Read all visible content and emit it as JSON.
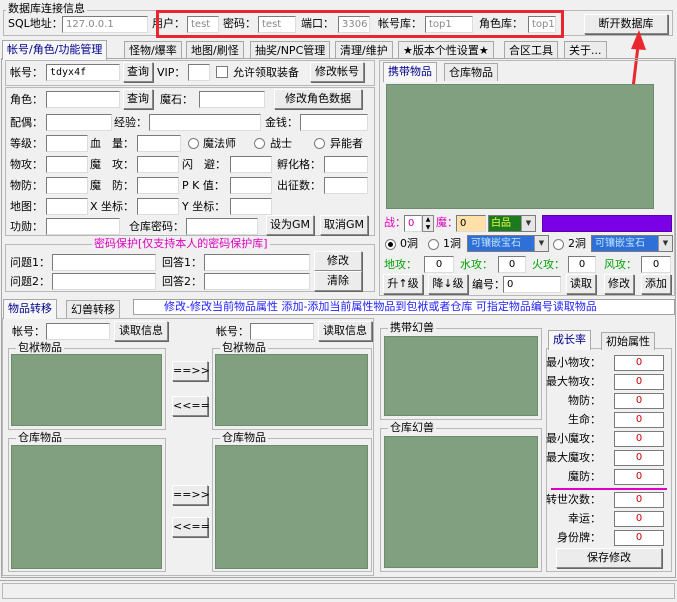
{
  "connection": {
    "group_title": "数据库连接信息",
    "sql_label": "SQL地址：",
    "sql_value": "127.0.0.1",
    "user_label": "用户：",
    "user_value": "test",
    "password_label": "密码：",
    "password_value": "test",
    "port_label": "端口：",
    "port_value": "3306",
    "account_db_label": "帐号库：",
    "account_db_value": "top1",
    "role_db_label": "角色库：",
    "role_db_value": "top1",
    "disconnect_label": "断开数据库"
  },
  "tabs": [
    "帐号/角色/功能管理",
    "怪物/爆率",
    "地图/刷怪",
    "抽奖/NPC管理",
    "清理/维护",
    "★版本个性设置★",
    "合区工具",
    "关于..."
  ],
  "account": {
    "account_label": "帐号：",
    "account_value": "tdyx4f",
    "query_label": "查询",
    "vip_label": "VIP：",
    "allow_label": "允许领取装备",
    "modify_account_label": "修改帐号"
  },
  "role": {
    "role_label": "角色：",
    "query_label": "查询",
    "magic_stone_label": "魔石：",
    "modify_role_label": "修改角色数据",
    "spouse_label": "配偶：",
    "exp_label": "经验：",
    "money_label": "金钱：",
    "level_label": "等级：",
    "hp_label": "血　量：",
    "class_mage": "魔法师",
    "class_warrior": "战士",
    "class_psychic": "异能者",
    "phys_atk_label": "物攻：",
    "magic_atk_label": "魔　攻：",
    "dodge_label": "闪　避：",
    "incubate_label": "孵化格：",
    "phys_def_label": "物防：",
    "magic_def_label": "魔　防：",
    "pk_label": "P K 值：",
    "departure_label": "出征数：",
    "map_label": "地图：",
    "x_label": "X 坐标：",
    "y_label": "Y 坐标：",
    "merit_label": "功勋：",
    "warehouse_pw_label": "仓库密码：",
    "set_gm_label": "设为GM",
    "cancel_gm_label": "取消GM"
  },
  "security": {
    "title": "密码保护[仅支持本人的密码保护库]",
    "q1_label": "问题1：",
    "a1_label": "回答1：",
    "modify_label": "修改",
    "q2_label": "问题2：",
    "a2_label": "回答2：",
    "clear_label": "清除"
  },
  "carry": {
    "tab_carry": "携带物品",
    "tab_warehouse": "仓库物品",
    "war_label": "战：",
    "war_value": "0",
    "magic_label": "魔：",
    "magic_value": "0",
    "quality_value": "白品",
    "quality_color": "#7a00e6",
    "hole0_label": "0洞",
    "hole1_label": "1洞",
    "hole2_label": "2洞",
    "gem_label_1": "可镶嵌宝石",
    "gem_label_2": "可镶嵌宝石",
    "earth_atk_label": "地攻：",
    "earth_value": "0",
    "water_atk_label": "水攻：",
    "water_value": "0",
    "fire_atk_label": "火攻：",
    "fire_value": "0",
    "wind_atk_label": "风攻：",
    "wind_value": "0",
    "upgrade_label": "升↑级",
    "downgrade_label": "降↓级",
    "id_label": "编号：",
    "id_value": "0",
    "read_label": "读取",
    "modify_label": "修改",
    "add_label": "添加"
  },
  "transfer": {
    "tab_items": "物品转移",
    "tab_pets": "幻兽转移",
    "hint": "修改-修改当前物品属性 添加-添加当前属性物品到包袱或者仓库 可指定物品编号读取物品",
    "account_label": "帐号：",
    "read_label": "读取信息",
    "bag_label": "包袱物品",
    "warehouse_label": "仓库物品",
    "move_right": "==>>",
    "move_left": "<<=="
  },
  "pets": {
    "carry_label": "携带幻兽",
    "warehouse_label": "仓库幻兽"
  },
  "growth": {
    "tab_growth": "成长率",
    "tab_initial": "初始属性",
    "rows": [
      {
        "label": "最小物攻：",
        "value": "0"
      },
      {
        "label": "最大物攻：",
        "value": "0"
      },
      {
        "label": "物防：",
        "value": "0"
      },
      {
        "label": "生命：",
        "value": "0"
      },
      {
        "label": "最小魔攻：",
        "value": "0"
      },
      {
        "label": "最大魔攻：",
        "value": "0"
      },
      {
        "label": "魔防：",
        "value": "0"
      }
    ],
    "rows2": [
      {
        "label": "转世次数：",
        "value": "0"
      },
      {
        "label": "幸运：",
        "value": "0"
      },
      {
        "label": "身份牌：",
        "value": "0"
      }
    ],
    "save_label": "保存修改"
  }
}
